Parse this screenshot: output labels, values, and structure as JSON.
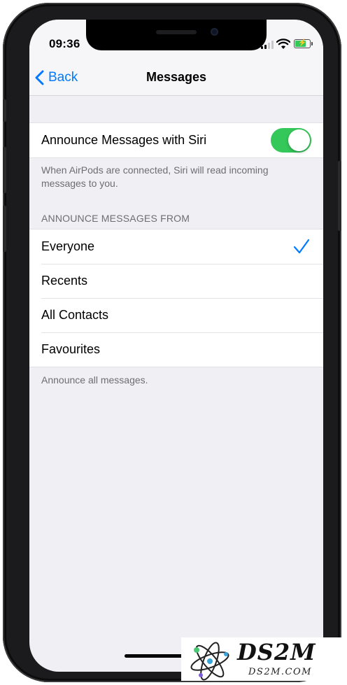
{
  "status_bar": {
    "time": "09:36"
  },
  "nav": {
    "back_label": "Back",
    "title": "Messages"
  },
  "announce_toggle": {
    "label": "Announce Messages with Siri",
    "on": true,
    "footer": "When AirPods are connected, Siri will read incoming messages to you."
  },
  "announce_from": {
    "header": "ANNOUNCE MESSAGES FROM",
    "options": [
      {
        "label": "Everyone",
        "selected": true
      },
      {
        "label": "Recents",
        "selected": false
      },
      {
        "label": "All Contacts",
        "selected": false
      },
      {
        "label": "Favourites",
        "selected": false
      }
    ],
    "footer": "Announce all messages."
  },
  "watermark": {
    "brand": "DS2M",
    "domain": "DS2M.COM"
  },
  "colors": {
    "accent": "#007aff",
    "toggle_on": "#34c759",
    "background": "#efeff4"
  }
}
